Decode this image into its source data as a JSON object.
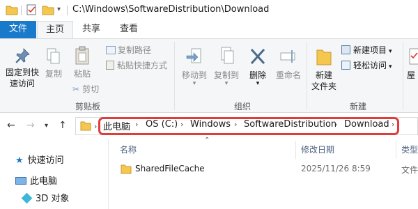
{
  "window": {
    "title_path": "C:\\Windows\\SoftwareDistribution\\Download"
  },
  "tabs": [
    {
      "label": "文件"
    },
    {
      "label": "主页"
    },
    {
      "label": "共享"
    },
    {
      "label": "查看"
    }
  ],
  "ribbon": {
    "clipboard": {
      "group_label": "剪贴板",
      "pin_label_1": "固定到快",
      "pin_label_2": "速访问",
      "copy_label": "复制",
      "paste_label": "粘贴",
      "copy_path_label": "复制路径",
      "paste_shortcut_label": "粘贴快捷方式",
      "cut_label": "剪切"
    },
    "organize": {
      "group_label": "组织",
      "move_to_label": "移动到",
      "copy_to_label": "复制到",
      "delete_label": "删除",
      "rename_label": "重命名"
    },
    "new": {
      "group_label": "新建",
      "new_folder_label_1": "新建",
      "new_folder_label_2": "文件夹",
      "new_item_label": "新建项目",
      "easy_access_label": "轻松访问"
    },
    "open": {
      "properties_label_partial": "屋"
    }
  },
  "address": {
    "crumbs": [
      "此电脑",
      "OS (C:)",
      "Windows",
      "SoftwareDistribution",
      "Download"
    ]
  },
  "nav_pane": {
    "items": [
      {
        "label": "快速访问",
        "icon": "star-icon"
      },
      {
        "label": "此电脑",
        "icon": "computer-icon"
      },
      {
        "label": "3D 对象",
        "icon": "cube-icon"
      }
    ]
  },
  "file_list": {
    "columns": [
      "名称",
      "修改日期",
      "类型"
    ],
    "rows": [
      {
        "name": "SharedFileCache",
        "modified": "2025/11/26 8:59",
        "type": "文件"
      }
    ]
  },
  "colors": {
    "file_tab": "#1979ca",
    "highlight_box": "#e23b3b",
    "folder": "#f5c74f"
  }
}
